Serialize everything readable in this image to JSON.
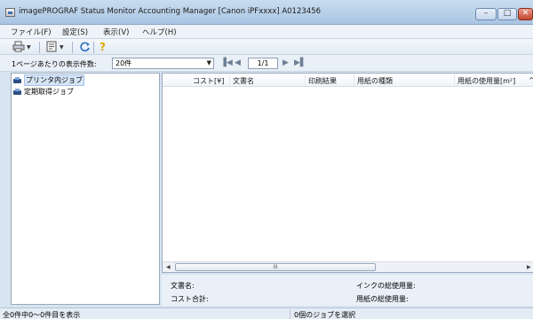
{
  "window": {
    "title": "imagePROGRAF Status Monitor Accounting Manager [Canon iPFxxxx]  A0123456",
    "minimize_label": "–",
    "maximize_label": "□",
    "close_label": "✕"
  },
  "menu": {
    "items": [
      {
        "label": "ファイル(F)"
      },
      {
        "label": "設定(S)"
      },
      {
        "label": "表示(V)"
      },
      {
        "label": "ヘルプ(H)"
      }
    ]
  },
  "toolbar": {
    "icons": [
      "printer-job-icon",
      "properties-icon",
      "refresh-icon",
      "help-icon"
    ]
  },
  "pagebar": {
    "per_page_label": "1ページあたりの表示件数:",
    "per_page_value": "20件",
    "page_value": "1/1"
  },
  "tree": {
    "items": [
      {
        "label": "プリンタ内ジョブ",
        "selected": true
      },
      {
        "label": "定期取得ジョブ",
        "selected": false
      }
    ]
  },
  "list": {
    "columns": [
      {
        "label": "コスト[¥]"
      },
      {
        "label": "文書名"
      },
      {
        "label": "印刷結果"
      },
      {
        "label": "用紙の種類"
      },
      {
        "label": "用紙の使用量[m²]"
      },
      {
        "label": "^"
      }
    ],
    "scroll_grip": "III"
  },
  "summary": {
    "doc_name_label": "文書名:",
    "cost_total_label": "コスト合計:",
    "ink_total_label": "インクの総使用量:",
    "paper_total_label": "用紙の総使用量:"
  },
  "status": {
    "left_text": "全0件中0〜0件目を表示",
    "mid_text": "0個のジョブを選択"
  },
  "colors": {
    "title_bar": "#b7cfe8",
    "window_bg": "#d8e4f1",
    "selection": "#d6e5f8",
    "close_button": "#c3462e"
  }
}
